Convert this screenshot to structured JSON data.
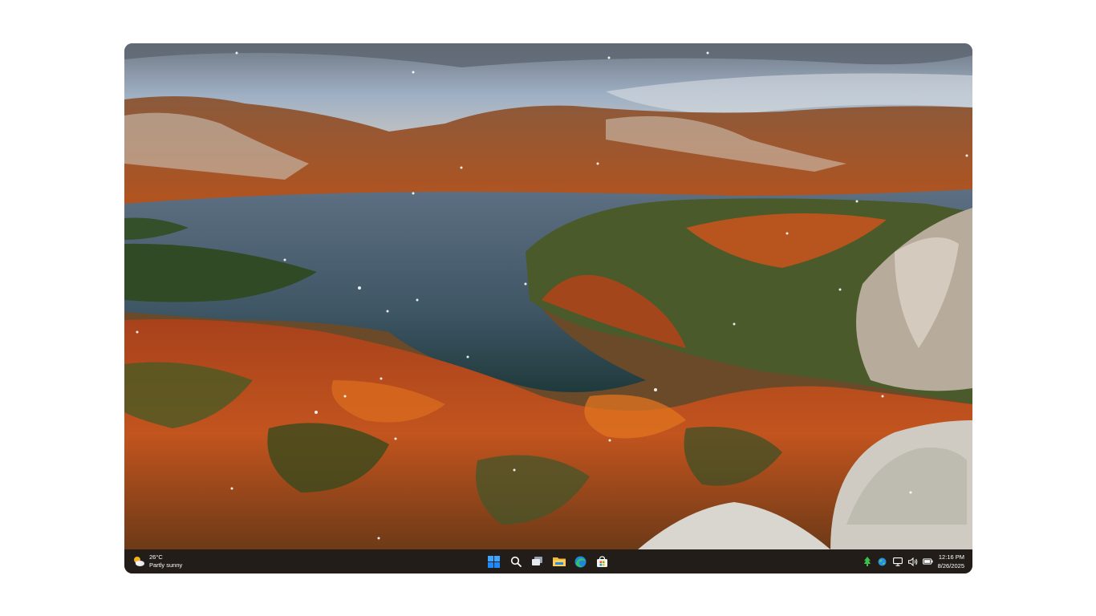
{
  "desktop": {
    "wallpaper_icon": "autumn-lake-landscape"
  },
  "taskbar": {
    "weather": {
      "temperature": "26°C",
      "condition": "Partly sunny",
      "icon": "partly-sunny-icon"
    },
    "apps": [
      {
        "name": "Start",
        "icon": "windows-start-icon"
      },
      {
        "name": "Search",
        "icon": "search-icon"
      },
      {
        "name": "Task View",
        "icon": "task-view-icon"
      },
      {
        "name": "File Explorer",
        "icon": "folder-icon"
      },
      {
        "name": "Microsoft Edge",
        "icon": "edge-browser-icon"
      },
      {
        "name": "Microsoft Store",
        "icon": "store-icon"
      }
    ],
    "tray": {
      "icons": [
        "app-tray-icon",
        "network-globe-icon",
        "display-icon",
        "volume-icon",
        "battery-icon"
      ]
    },
    "clock": {
      "time": "12:16 PM",
      "date": "8/26/2025"
    }
  },
  "colors": {
    "taskbar_bg": "#221d18",
    "accent": "#0078d4"
  }
}
